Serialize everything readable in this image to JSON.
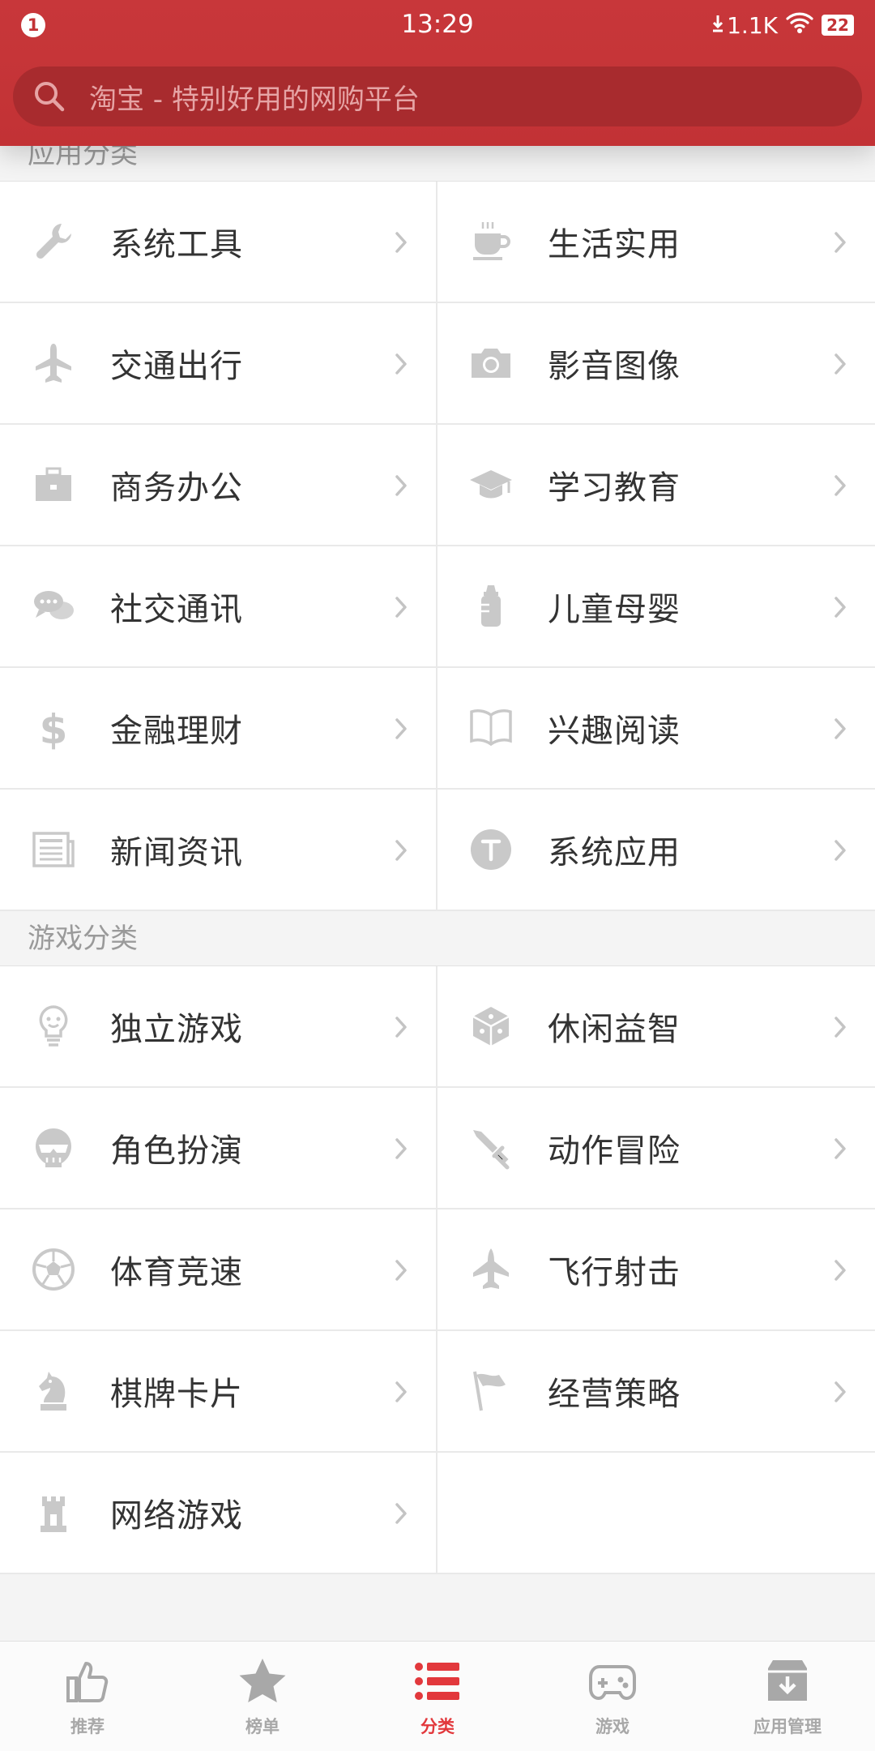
{
  "status_bar": {
    "notification_count": "1",
    "time": "13:29",
    "net_speed": "1.1K",
    "battery": "22"
  },
  "search": {
    "placeholder": "淘宝 - 特别好用的网购平台"
  },
  "sections": [
    {
      "title": "应用分类",
      "items": [
        {
          "label": "系统工具",
          "icon": "wrench-icon"
        },
        {
          "label": "生活实用",
          "icon": "coffee-cup-icon"
        },
        {
          "label": "交通出行",
          "icon": "airplane-icon"
        },
        {
          "label": "影音图像",
          "icon": "camera-icon"
        },
        {
          "label": "商务办公",
          "icon": "briefcase-icon"
        },
        {
          "label": "学习教育",
          "icon": "graduation-cap-icon"
        },
        {
          "label": "社交通讯",
          "icon": "chat-bubbles-icon"
        },
        {
          "label": "儿童母婴",
          "icon": "baby-bottle-icon"
        },
        {
          "label": "金融理财",
          "icon": "dollar-icon"
        },
        {
          "label": "兴趣阅读",
          "icon": "open-book-icon"
        },
        {
          "label": "新闻资讯",
          "icon": "newspaper-icon"
        },
        {
          "label": "系统应用",
          "icon": "t-circle-icon"
        }
      ]
    },
    {
      "title": "游戏分类",
      "items": [
        {
          "label": "独立游戏",
          "icon": "lightbulb-icon"
        },
        {
          "label": "休闲益智",
          "icon": "cube-icon"
        },
        {
          "label": "角色扮演",
          "icon": "mask-icon"
        },
        {
          "label": "动作冒险",
          "icon": "sword-icon"
        },
        {
          "label": "体育竞速",
          "icon": "soccer-ball-icon"
        },
        {
          "label": "飞行射击",
          "icon": "jet-icon"
        },
        {
          "label": "棋牌卡片",
          "icon": "chess-knight-icon"
        },
        {
          "label": "经营策略",
          "icon": "flag-icon"
        },
        {
          "label": "网络游戏",
          "icon": "castle-tower-icon"
        }
      ]
    }
  ],
  "bottom_nav": [
    {
      "label": "推荐",
      "icon": "thumbs-up-icon",
      "active": false
    },
    {
      "label": "榜单",
      "icon": "star-icon",
      "active": false
    },
    {
      "label": "分类",
      "icon": "list-icon",
      "active": true
    },
    {
      "label": "游戏",
      "icon": "gamepad-icon",
      "active": false
    },
    {
      "label": "应用管理",
      "icon": "download-box-icon",
      "active": false
    }
  ],
  "colors": {
    "brand_red": "#c23235",
    "active_tab": "#e2383c",
    "icon_gray": "#c9c9c9"
  }
}
